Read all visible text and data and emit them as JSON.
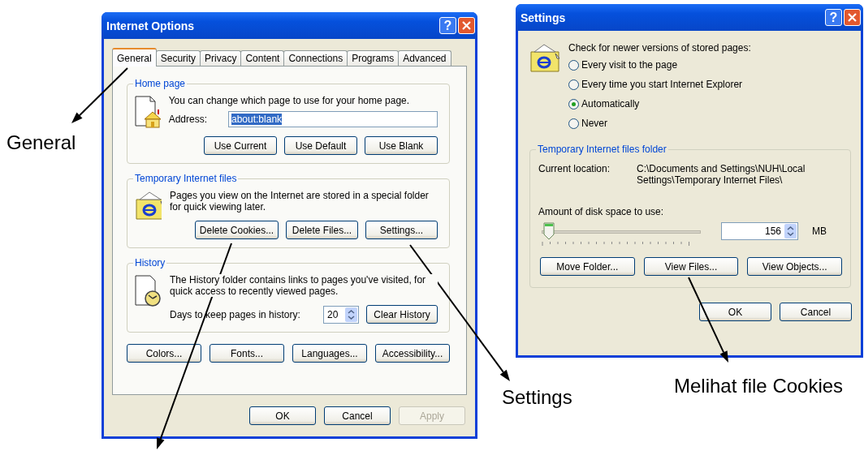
{
  "internet_options": {
    "title": "Internet Options",
    "help": "?",
    "tabs": [
      {
        "label": "General",
        "selected": true
      },
      {
        "label": "Security",
        "selected": false
      },
      {
        "label": "Privacy",
        "selected": false
      },
      {
        "label": "Content",
        "selected": false
      },
      {
        "label": "Connections",
        "selected": false
      },
      {
        "label": "Programs",
        "selected": false
      },
      {
        "label": "Advanced",
        "selected": false
      }
    ],
    "home_page": {
      "heading": "Home page",
      "description": "You can change which page to use for your home page.",
      "address_label": "Address:",
      "address_value": "about:blank",
      "buttons": [
        "Use Current",
        "Use Default",
        "Use Blank"
      ]
    },
    "temporary_files": {
      "heading": "Temporary Internet files",
      "description": "Pages you view on the Internet are stored in a special folder for quick viewing later.",
      "buttons": [
        "Delete Cookies...",
        "Delete Files...",
        "Settings..."
      ]
    },
    "history": {
      "heading": "History",
      "description": "The History folder contains links to pages you've visited, for quick access to recently viewed pages.",
      "days_label": "Days to keep pages in history:",
      "days_value": "20",
      "buttons": [
        "Clear History"
      ]
    },
    "buttons": [
      "Colors...",
      "Fonts...",
      "Languages...",
      "Accessibility..."
    ],
    "footer_buttons": [
      {
        "label": "OK",
        "disabled": false
      },
      {
        "label": "Cancel",
        "disabled": false
      },
      {
        "label": "Apply",
        "disabled": true
      }
    ]
  },
  "settings": {
    "title": "Settings",
    "help": "?",
    "check_label": "Check for newer versions of stored pages:",
    "options": [
      {
        "label": "Every visit to the page",
        "selected": false
      },
      {
        "label": "Every time you start Internet Explorer",
        "selected": false
      },
      {
        "label": "Automatically",
        "selected": true
      },
      {
        "label": "Never",
        "selected": false
      }
    ],
    "folder": {
      "heading": "Temporary Internet files folder",
      "location_label": "Current location:",
      "location_value": "C:\\Documents and Settings\\NUH\\Local Settings\\Temporary Internet Files\\",
      "disk_label": "Amount of disk space to use:",
      "slider": {
        "level": 0.03
      },
      "disk_value": "156",
      "unit": "MB",
      "buttons": [
        "Move Folder...",
        "View Files...",
        "View Objects..."
      ]
    },
    "footer_buttons": [
      {
        "label": "OK",
        "disabled": false
      },
      {
        "label": "Cancel",
        "disabled": false
      }
    ]
  },
  "callouts": [
    {
      "text": "General"
    },
    {
      "text": "Settings"
    },
    {
      "text": "Melihat file Cookies"
    }
  ]
}
